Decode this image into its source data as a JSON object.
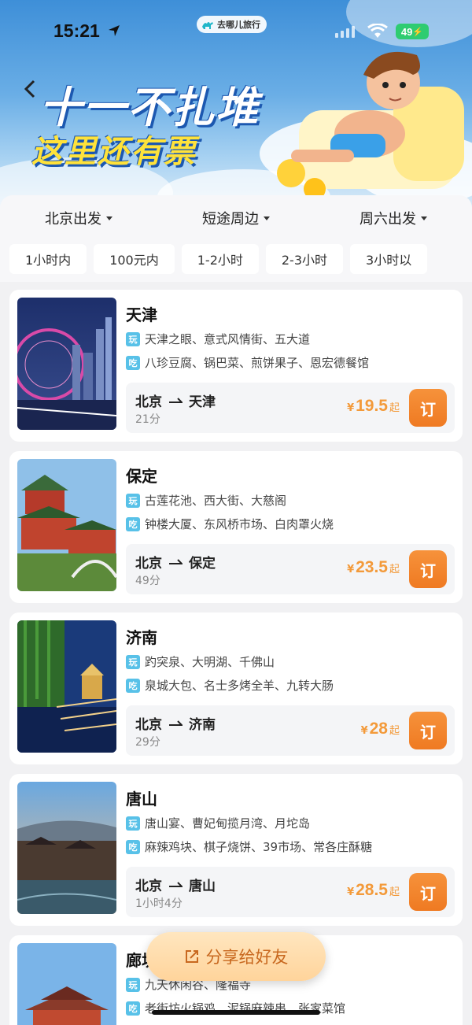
{
  "status_bar": {
    "time": "15:21",
    "battery": "49"
  },
  "brand": {
    "name": "去哪儿旅行"
  },
  "banner": {
    "line1": "十一不扎堆",
    "line2": "这里还有票"
  },
  "dropdowns": [
    {
      "label": "北京出发"
    },
    {
      "label": "短途周边"
    },
    {
      "label": "周六出发"
    }
  ],
  "chips": [
    "1小时内",
    "100元内",
    "1-2小时",
    "2-3小时",
    "3小时以"
  ],
  "tags": {
    "play": "玩",
    "eat": "吃"
  },
  "currency": "¥",
  "price_suffix": "起",
  "book_label": "订",
  "destinations": [
    {
      "city": "天津",
      "play": "天津之眼、意式风情街、五大道",
      "eat": "八珍豆腐、锅巴菜、煎饼果子、恩宏德餐馆",
      "from": "北京",
      "to": "天津",
      "duration": "21分",
      "price": "19.5"
    },
    {
      "city": "保定",
      "play": "古莲花池、西大街、大慈阁",
      "eat": "钟楼大厦、东风桥市场、白肉罩火烧",
      "from": "北京",
      "to": "保定",
      "duration": "49分",
      "price": "23.5"
    },
    {
      "city": "济南",
      "play": "趵突泉、大明湖、千佛山",
      "eat": "泉城大包、名士多烤全羊、九转大肠",
      "from": "北京",
      "to": "济南",
      "duration": "29分",
      "price": "28"
    },
    {
      "city": "唐山",
      "play": "唐山宴、曹妃甸揽月湾、月坨岛",
      "eat": "麻辣鸡块、棋子烧饼、39市场、常各庄酥糖",
      "from": "北京",
      "to": "唐山",
      "duration": "1小时4分",
      "price": "28.5"
    },
    {
      "city": "廊坊",
      "play": "九天休闲谷、隆福寺",
      "eat": "老街坊火锅鸡、泥锅麻辣串、张家菜馆"
    }
  ],
  "share": {
    "label": "分享给好友"
  },
  "colors": {
    "accent": "#f39a3a",
    "tag": "#58c1e8",
    "book": "#ef7a22"
  }
}
